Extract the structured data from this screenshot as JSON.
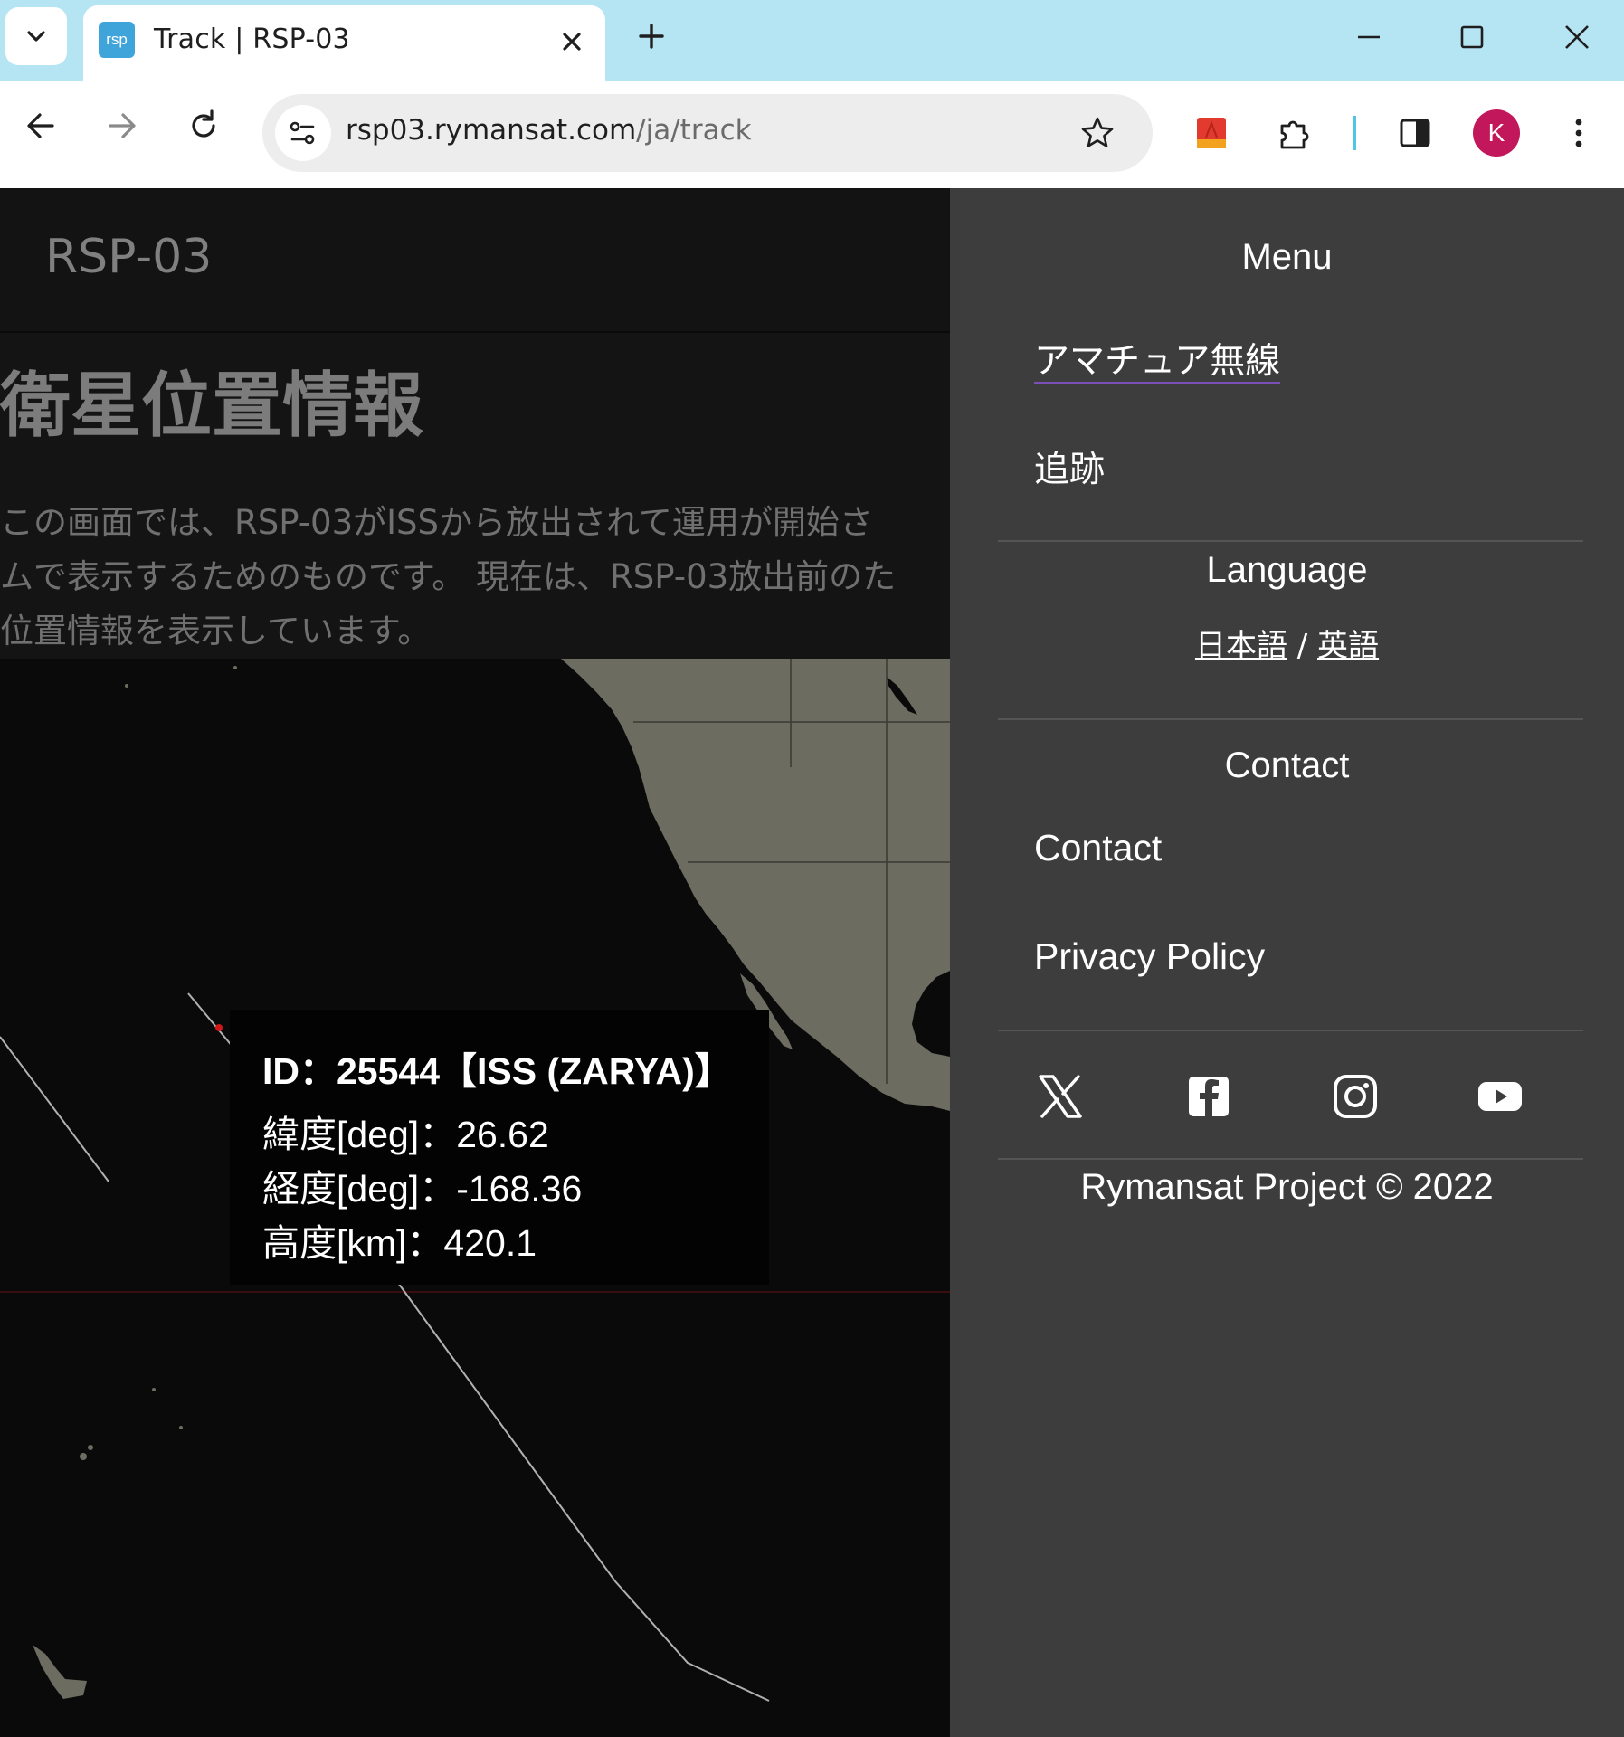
{
  "browser": {
    "tab": {
      "favicon_text": "rsp",
      "title": "Track | RSP-03",
      "accent": "#3fa4d9"
    },
    "url": {
      "host": "rsp03.rymansat.com",
      "path": "/ja/track"
    },
    "profile_initial": "K",
    "profile_color": "#c2185b",
    "icons": [
      "tab-list-icon",
      "close-icon",
      "plus-icon",
      "minimize-icon",
      "maximize-icon",
      "close-window-icon",
      "back-icon",
      "forward-icon",
      "reload-icon",
      "site-info-icon",
      "bookmark-star-icon",
      "extension-app-icon",
      "puzzle-icon",
      "side-panel-icon",
      "more-vert-icon"
    ]
  },
  "site": {
    "brand": "RSP-03",
    "title": "衛星位置情報",
    "intro_lines": [
      "この画面では、RSP-03がISSから放出されて運用が開始さ",
      "ムで表示するためのものです。 現在は、RSP-03放出前のた",
      "位置情報を表示しています。"
    ]
  },
  "tooltip": {
    "title": "ID：25544【ISS (ZARYA)】",
    "lat": "緯度[deg]：26.62",
    "lon": "経度[deg]：-168.36",
    "alt": "高度[km]：420.1"
  },
  "menu": {
    "heading": "Menu",
    "items": [
      {
        "label": "アマチュア無線"
      },
      {
        "label": "追跡"
      }
    ],
    "language_heading": "Language",
    "languages": {
      "ja": "日本語",
      "sep": "/",
      "en": "英語"
    },
    "contact_heading": "Contact",
    "contact_items": [
      {
        "label": "Contact"
      },
      {
        "label": "Privacy Policy"
      }
    ],
    "social": [
      "x-icon",
      "facebook-icon",
      "instagram-icon",
      "youtube-icon"
    ],
    "copyright": "Rymansat Project © 2022"
  }
}
